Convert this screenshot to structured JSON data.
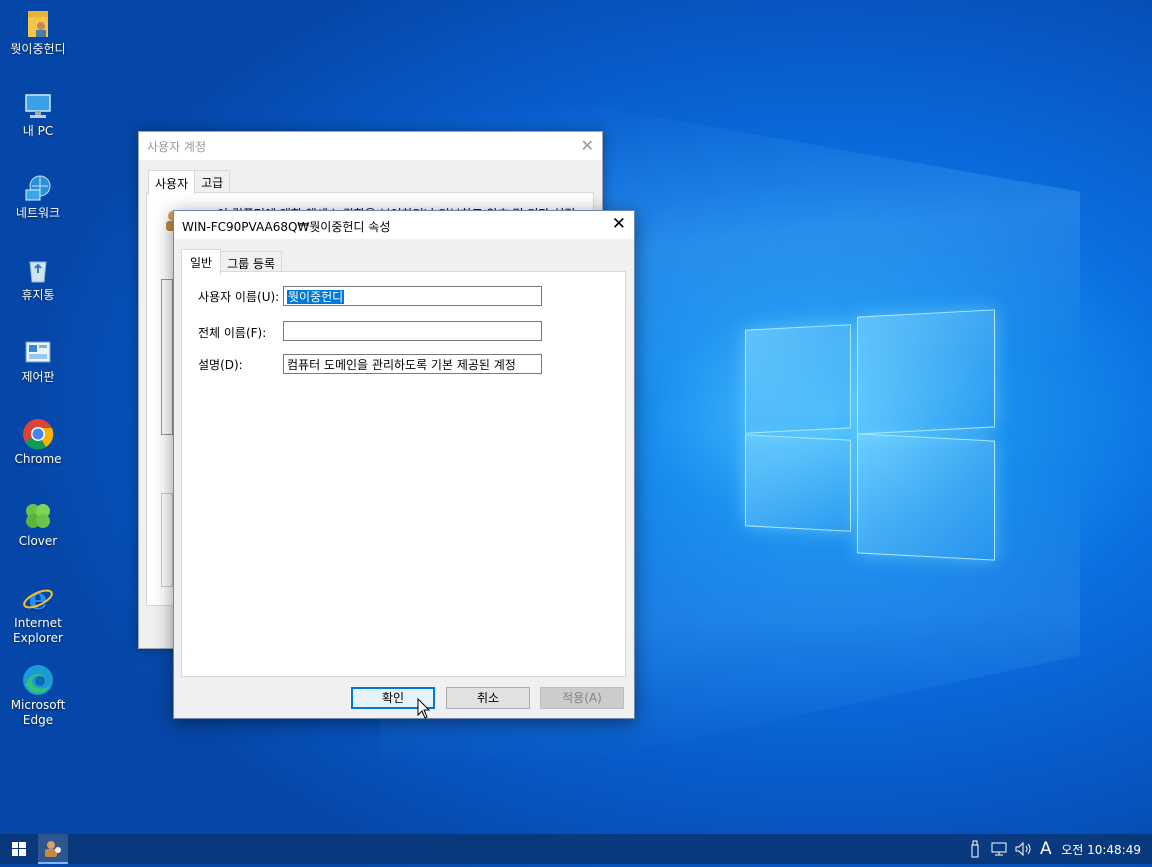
{
  "desktop": {
    "icons": [
      {
        "label": "뭣이중헌디",
        "icon": "user-folder-icon"
      },
      {
        "label": "내 PC",
        "icon": "computer-icon"
      },
      {
        "label": "네트워크",
        "icon": "network-icon"
      },
      {
        "label": "휴지통",
        "icon": "recycle-bin-icon"
      },
      {
        "label": "제어판",
        "icon": "control-panel-icon"
      },
      {
        "label": "Chrome",
        "icon": "chrome-icon"
      },
      {
        "label": "Clover",
        "icon": "clover-icon"
      },
      {
        "label": "Internet Explorer",
        "icon": "ie-icon"
      },
      {
        "label": "Microsoft Edge",
        "icon": "edge-icon"
      }
    ]
  },
  "back_window": {
    "title": "사용자 계정",
    "tabs": [
      "사용자",
      "고급"
    ],
    "obscured_text": "이 컴퓨터에 대한 액세스 권한을 부여하거나 거부하고 암호 및 기타 설정을 변경하려면 아래 목록을 사용하십시오."
  },
  "dialog": {
    "title": "WIN-FC90PVAA68Q₩뭣이중헌디 속성",
    "tabs": [
      "일반",
      "그룹 등록"
    ],
    "fields": {
      "username_label": "사용자 이름(U):",
      "username_value": "뭣이중헌디",
      "fullname_label": "전체 이름(F):",
      "fullname_value": "",
      "desc_label": "설명(D):",
      "desc_value": "컴퓨터 도메인을 관리하도록 기본 제공된 계정"
    },
    "buttons": {
      "ok": "확인",
      "cancel": "취소",
      "apply": "적용(A)"
    }
  },
  "taskbar": {
    "clock": "오전 10:48:49",
    "ime": "A"
  }
}
